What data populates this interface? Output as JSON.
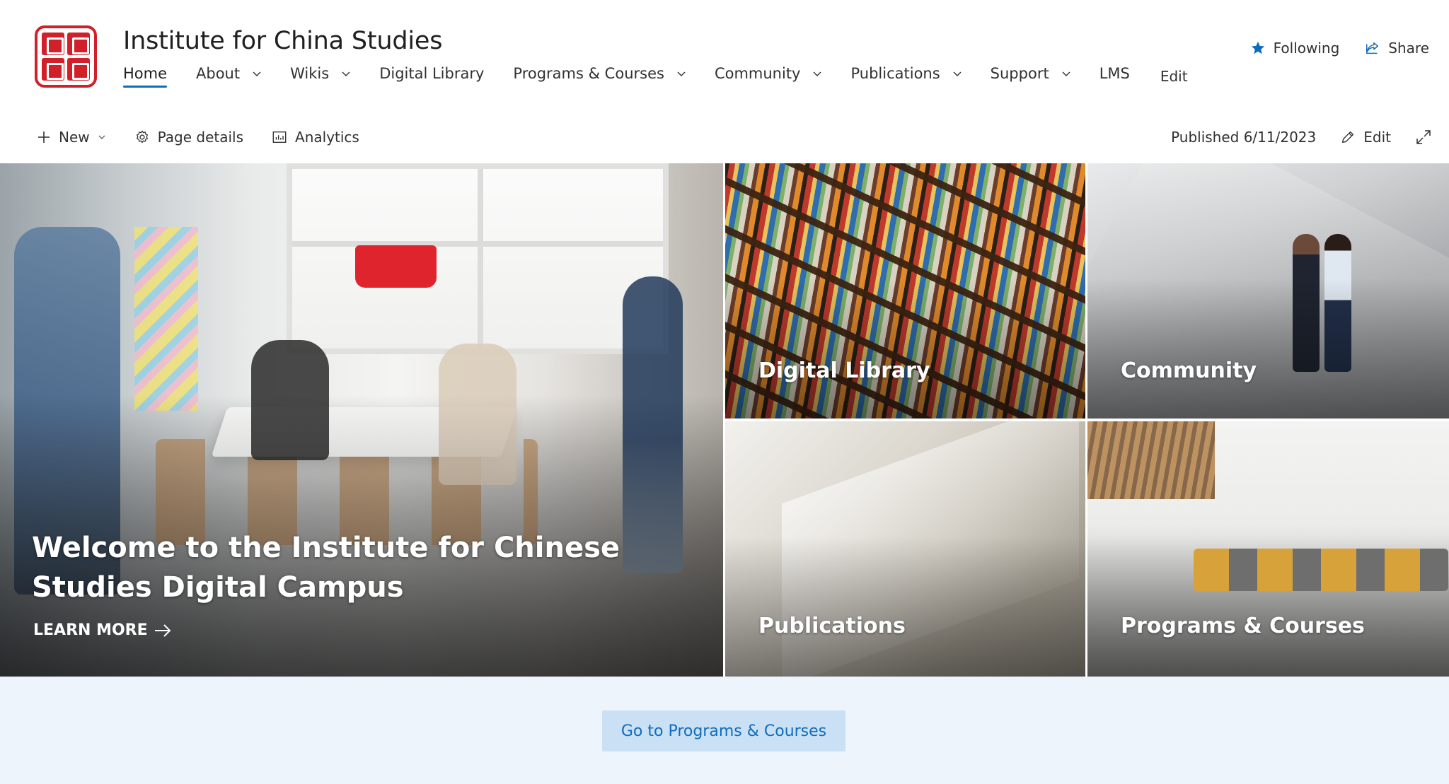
{
  "site": {
    "title": "Institute for China Studies"
  },
  "nav": {
    "items": [
      {
        "label": "Home",
        "active": true,
        "has_menu": false
      },
      {
        "label": "About",
        "active": false,
        "has_menu": true
      },
      {
        "label": "Wikis",
        "active": false,
        "has_menu": true
      },
      {
        "label": "Digital Library",
        "active": false,
        "has_menu": false
      },
      {
        "label": "Programs & Courses",
        "active": false,
        "has_menu": true
      },
      {
        "label": "Community",
        "active": false,
        "has_menu": true
      },
      {
        "label": "Publications",
        "active": false,
        "has_menu": true
      },
      {
        "label": "Support",
        "active": false,
        "has_menu": true
      },
      {
        "label": "LMS",
        "active": false,
        "has_menu": false
      }
    ],
    "edit_label": "Edit"
  },
  "header_actions": {
    "following_label": "Following",
    "share_label": "Share"
  },
  "command_bar": {
    "new_label": "New",
    "page_details_label": "Page details",
    "analytics_label": "Analytics",
    "published_text": "Published 6/11/2023",
    "edit_label": "Edit"
  },
  "hero": {
    "main": {
      "title": "Welcome to the Institute for Chinese Studies Digital Campus",
      "link_label": "LEARN MORE"
    },
    "tiles": [
      {
        "label": "Digital Library"
      },
      {
        "label": "Community"
      },
      {
        "label": "Publications"
      },
      {
        "label": "Programs & Courses"
      }
    ]
  },
  "cta": {
    "label": "Go to Programs & Courses"
  },
  "colors": {
    "accent": "#0f6cbd",
    "logo_red": "#d1202a",
    "band_bg": "#eef4fb",
    "cta_bg": "#c9e0f5"
  },
  "icons": [
    "star-icon",
    "share-icon",
    "plus-icon",
    "chevron-down-icon",
    "gear-icon",
    "analytics-icon",
    "pencil-icon",
    "expand-icon",
    "arrow-right-icon"
  ]
}
